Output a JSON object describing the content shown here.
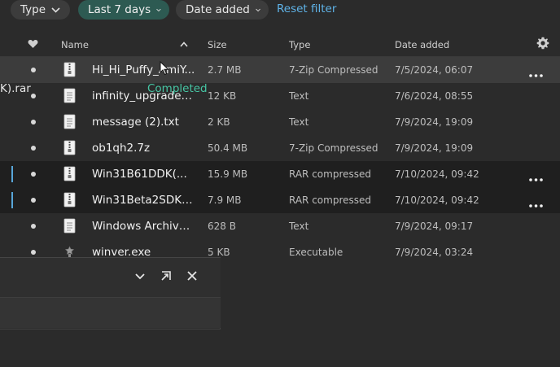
{
  "filters": {
    "type_label": "Type",
    "date_range_label": "Last 7 days",
    "sort_label": "Date added",
    "reset_label": "Reset filter"
  },
  "columns": {
    "name": "Name",
    "size": "Size",
    "type": "Type",
    "date_added": "Date added"
  },
  "files": [
    {
      "name": "Hi_Hi_Puffy_AmiY...",
      "size": "2.7 MB",
      "type": "7-Zip Compressed",
      "date": "7/5/2024, 06:07",
      "icon": "archive-file-icon",
      "state": "hover"
    },
    {
      "name": "infinity_upgrades_...",
      "size": "12 KB",
      "type": "Text",
      "date": "7/6/2024, 08:55",
      "icon": "text-file-icon",
      "state": "normal"
    },
    {
      "name": "message (2).txt",
      "size": "2 KB",
      "type": "Text",
      "date": "7/9/2024, 19:09",
      "icon": "text-file-icon",
      "state": "normal"
    },
    {
      "name": "ob1qh2.7z",
      "size": "50.4 MB",
      "type": "7-Zip Compressed",
      "date": "7/9/2024, 19:09",
      "icon": "archive-file-icon",
      "state": "normal"
    },
    {
      "name": "Win31B61DDK(...",
      "size": "15.9 MB",
      "type": "RAR compressed",
      "date": "7/10/2024, 09:42",
      "icon": "archive-file-icon",
      "state": "selected"
    },
    {
      "name": "Win31Beta2SDK(...",
      "size": "7.9 MB",
      "type": "RAR compressed",
      "date": "7/10/2024, 09:42",
      "icon": "archive-file-icon",
      "state": "selected"
    },
    {
      "name": "Windows Archive ...",
      "size": "628 B",
      "type": "Text",
      "date": "7/9/2024, 09:17",
      "icon": "text-file-icon",
      "state": "normal"
    },
    {
      "name": "winver.exe",
      "size": "5 KB",
      "type": "Executable",
      "date": "7/9/2024, 03:24",
      "icon": "executable-icon",
      "state": "normal"
    }
  ],
  "download_panel": {
    "item_name": "K).rar",
    "item_status": "Completed"
  },
  "colors": {
    "accent_link": "#5fb3e8",
    "active_pill": "#2d5a52",
    "completed": "#46c6a4",
    "selection_bar": "#58a6d9"
  }
}
